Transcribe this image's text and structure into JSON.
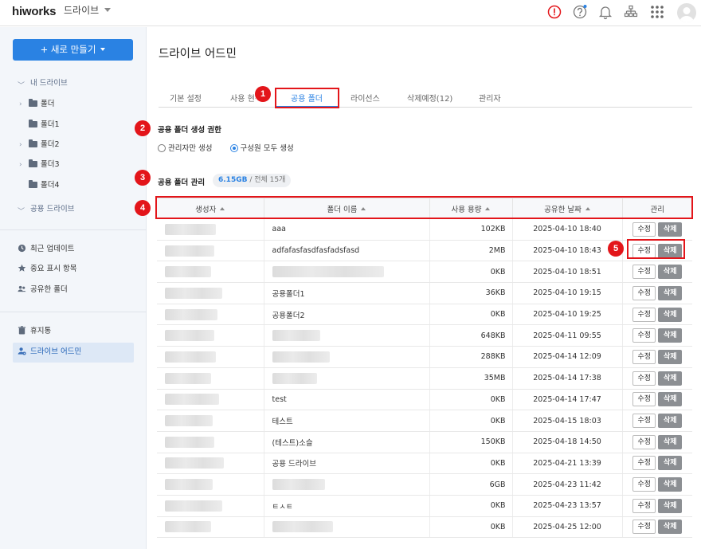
{
  "header": {
    "logo": "hiworks",
    "app_name": "드라이브",
    "icons": [
      "alert-icon",
      "help-icon",
      "bell-icon",
      "org-chart-icon",
      "app-grid-icon",
      "avatar"
    ]
  },
  "sidebar": {
    "new_button": "+ 새로 만들기",
    "my_drive": "내 드라이브",
    "folders": [
      "폴더",
      "폴더1",
      "폴더2",
      "폴더3",
      "폴더4"
    ],
    "shared_drive": "공용 드라이브",
    "links": [
      {
        "label": "최근 업데이트",
        "icon": "clock-icon"
      },
      {
        "label": "중요 표시 항목",
        "icon": "star-icon"
      },
      {
        "label": "공유한 폴더",
        "icon": "people-icon"
      }
    ],
    "trash": "휴지통",
    "admin": "드라이브 어드민"
  },
  "main": {
    "title": "드라이브 어드민",
    "tabs": [
      "기본 설정",
      "사용 현황",
      "공용 폴더",
      "라이선스",
      "삭제예정(12)",
      "관리자"
    ],
    "perm_title": "공용 폴더 생성 권한",
    "perm_options": [
      "관리자만 생성",
      "구성원 모두 생성"
    ],
    "manage_title": "공용 폴더 관리",
    "usage_used": "6.15GB",
    "usage_rest": " / 전체 15개",
    "columns": [
      "생성자",
      "폴더 이름",
      "사용 용량",
      "공유한 날짜",
      "관리"
    ],
    "edit_label": "수정",
    "delete_label": "삭제",
    "rows": [
      {
        "name": "aaa",
        "size": "102KB",
        "date": "2025-04-10 18:40"
      },
      {
        "name": "adfafasfasdfasfadsfasd",
        "size": "2MB",
        "date": "2025-04-10 18:43"
      },
      {
        "name": "",
        "size": "0KB",
        "date": "2025-04-10 18:51"
      },
      {
        "name": "공용폴더1",
        "size": "36KB",
        "date": "2025-04-10 19:15"
      },
      {
        "name": "공용폴더2",
        "size": "0KB",
        "date": "2025-04-10 19:25"
      },
      {
        "name": "",
        "size": "648KB",
        "date": "2025-04-11 09:55"
      },
      {
        "name": "",
        "size": "288KB",
        "date": "2025-04-14 12:09"
      },
      {
        "name": "",
        "size": "35MB",
        "date": "2025-04-14 17:38"
      },
      {
        "name": "test",
        "size": "0KB",
        "date": "2025-04-14 17:47"
      },
      {
        "name": "테스트",
        "size": "0KB",
        "date": "2025-04-15 18:03"
      },
      {
        "name": "(테스트)소슬",
        "size": "150KB",
        "date": "2025-04-18 14:50"
      },
      {
        "name": "공용 드라이브",
        "size": "0KB",
        "date": "2025-04-21 13:39"
      },
      {
        "name": "",
        "size": "6GB",
        "date": "2025-04-23 11:42"
      },
      {
        "name": "ㅌㅅㅌ",
        "size": "0KB",
        "date": "2025-04-23 13:57"
      },
      {
        "name": "",
        "size": "0KB",
        "date": "2025-04-25 12:00"
      }
    ]
  },
  "annotations": [
    "1",
    "2",
    "3",
    "4",
    "5"
  ],
  "colors": {
    "accent": "#2a82e3",
    "annotation": "#e3151a",
    "sidebar_bg": "#f3f6fa"
  }
}
